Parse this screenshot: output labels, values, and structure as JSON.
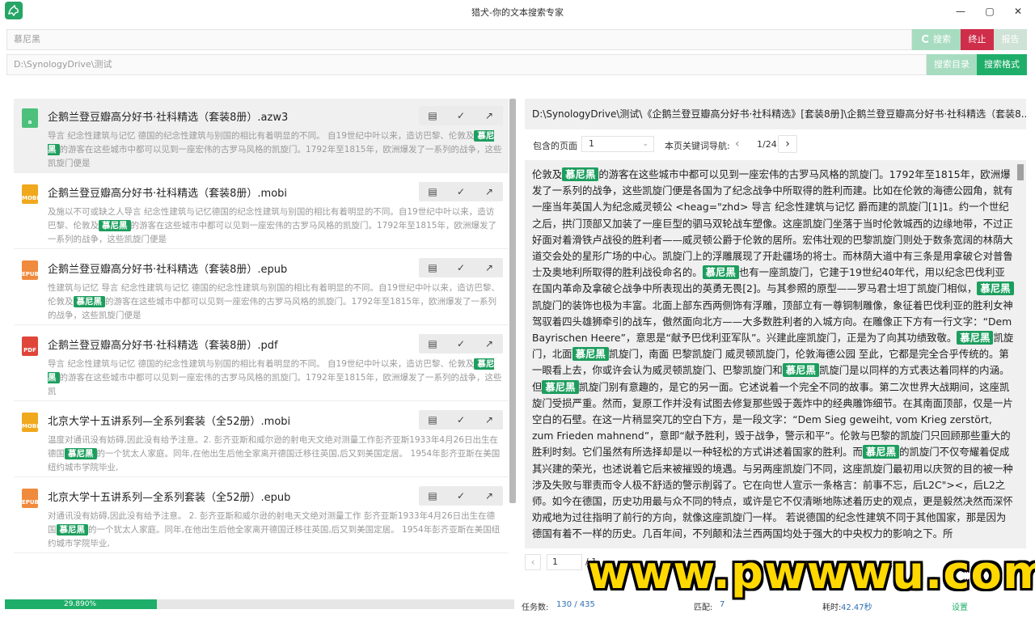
{
  "window": {
    "title": "猎犬-你的文本搜索专家",
    "controls": {
      "minimize": "—",
      "maximize": "▢",
      "close": "✕"
    }
  },
  "search": {
    "keyword": "慕尼黑",
    "search_button": "搜索",
    "stop_button": "终止",
    "report_button": "报告",
    "directory": "D:\\SynologyDrive\\测试",
    "search_dir_button": "搜索目录",
    "search_format_button": "搜索格式"
  },
  "colors": {
    "accent": "#1fae6a",
    "accent_light": "#a7dcc0",
    "stop": "#cf2e4a",
    "report": "#cfe2d6",
    "highlight": "#1c9e5e"
  },
  "results": [
    {
      "icon": "azw3-file-icon",
      "icon_text": "a",
      "icon_color": "#4cc07c",
      "title": "企鹅兰登豆瓣高分好书·社科精选（套装8册）.azw3",
      "snippet_pre": "导言 纪念性建筑与记忆 德国的纪念性建筑与别国的相比有着明显的不同。 自19世纪中叶以来，造访巴黎、伦敦及",
      "keyword": "慕尼黑",
      "snippet_post": "的游客在这些城市中都可以见到一座宏伟的古罗马风格的凯旋门。1792年至1815年，欧洲爆发了一系列的战争，这些凯旋门便是"
    },
    {
      "icon": "mobi-file-icon",
      "icon_text": "MOBI",
      "icon_color": "#f0a81c",
      "title": "企鹅兰登豆瓣高分好书·社科精选（套装8册）.mobi",
      "snippet_pre": "及施以不可或缺之人导言 纪念性建筑与记忆德国的纪念性建筑与别国的相比有着明显的不同。自19世纪中叶以来，造访巴黎、伦敦及",
      "keyword": "慕尼黑",
      "snippet_post": "的游客在这些城市中都可以见到一座宏伟的古罗马风格的凯旋门。1792年至1815年，欧洲爆发了一系列的战争，这些凯旋门便是"
    },
    {
      "icon": "epub-file-icon",
      "icon_text": "EPUB",
      "icon_color": "#f08a3c",
      "title": "企鹅兰登豆瓣高分好书·社科精选（套装8册）.epub",
      "snippet_pre": "性建筑与记忆 导言 纪念性建筑与记忆 德国的纪念性建筑与别国的相比有着明显的不同。自19世纪中叶以来，造访巴黎、伦敦及",
      "keyword": "慕尼黑",
      "snippet_post": "的游客在这些城市中都可以见到一座宏伟的古罗马风格的凯旋门。1792年至1815年，欧洲爆发了一系列的战争，这些凯旋门便是"
    },
    {
      "icon": "pdf-file-icon",
      "icon_text": "PDF",
      "icon_color": "#e0453a",
      "title": "企鹅兰登豆瓣高分好书·社科精选（套装8册）.pdf",
      "snippet_pre": "导言 纪念性建筑与记忆 德国的纪念性建筑与别国的相比有着明显的不同。 自19世纪中叶以来，造访巴黎、伦敦及",
      "keyword": "慕尼黑",
      "snippet_post": "的游客在这些城市中都可以见到一座宏伟的古罗马风格的凯旋门。1792年至1815年，欧洲爆发了一系列的战争，这些凯"
    },
    {
      "icon": "mobi-file-icon",
      "icon_text": "MOBI",
      "icon_color": "#f0a81c",
      "title": "北京大学十五讲系列—全系列套装（全52册）.mobi",
      "snippet_pre": "温度对通讯没有妨碍,因此没有给予注意。2. 彭齐亚斯和威尔逊的射电天文绝对测量工作彭齐亚斯1933年4月26日出生在德国",
      "keyword": "慕尼黑",
      "snippet_post": "的一个犹太人家庭。同年,在他出生后他全家离开德国迁移往英国,后又到美国定居。 1954年彭齐亚斯在美国纽约城市学院毕业,"
    },
    {
      "icon": "epub-file-icon",
      "icon_text": "EPUB",
      "icon_color": "#f08a3c",
      "title": "北京大学十五讲系列—全系列套装（全52册）.epub",
      "snippet_pre": "对通讯没有妨碍,因此没有给予注意。 2. 彭齐亚斯和威尔逊的射电天文绝对测量工作 彭齐亚斯1933年4月26日出生在德国",
      "keyword": "慕尼黑",
      "snippet_post": "的一个犹太人家庭。同年,在他出生后他全家离开德国迁移往英国,后又到美国定居。 1954年彭齐亚斯在美国纽约城市学院毕业,"
    }
  ],
  "detail": {
    "path": "D:\\SynologyDrive\\测试\\《企鹅兰登豆瓣高分好书·社科精选》[套装8册]\\企鹅兰登豆瓣高分好书·社科精选（套装8...",
    "pages_label": "包含的页面",
    "page_select": "1",
    "keyword_nav_label": "本页关键词导航:",
    "keyword_index": "1/24",
    "page_input": "1",
    "page_total": "/ 1",
    "preview": [
      {
        "t": "伦敦及"
      },
      {
        "k": "慕尼黑"
      },
      {
        "t": "的游客在这些城市中都可以见到一座宏伟的古罗马风格的凯旋门。1792年至1815年，欧洲爆发了一系列的战争，这些凯旋门便是各国为了纪念战争中所取得的胜利而建。比如在伦敦的海德公园角，就有一座当年英国人为纪念威灵顿公 <heag=\"zhd> 导言 纪念性建筑与记忆 爵而建的凯旋门[1]1。约一个世纪之后，拱门顶部又加装了一座巨型的驷马双轮战车塑像。这座凯旋门坐落于当时伦敦城西的边缘地带，不过正好面对着滑铁卢战役的胜利者——威灵顿公爵于伦敦的居所。宏伟壮观的巴黎凯旋门则处于数条宽阔的林荫大道交会处的星形广场的中心。凯旋门上的浮雕展现了开赴疆场的将士。而林荫大道中有三条是用拿破仑对普鲁士及奥地利所取得的胜利战役命名的。"
      },
      {
        "k": "慕尼黑"
      },
      {
        "t": "也有一座凯旋门，它建于19世纪40年代，用以纪念巴伐利亚在国内革命及拿破仑战争中所表现出的英勇无畏[2]。与其参照的原型——罗马君士坦丁凯旋门相似，"
      },
      {
        "k": "慕尼黑"
      },
      {
        "t": "凯旋门的装饰也极为丰富。北面上部东西两侧饰有浮雕，顶部立有一尊铜制雕像，象征着巴伐利亚的胜利女神驾驭着四头雄狮牵引的战车，傲然面向北方——大多数胜利者的入城方向。在雕像正下方有一行文字：“Dem Bayrischen Heere”，意思是“献予巴伐利亚军队”。兴建此座凯旋门，正是为了向其功绩致敬。"
      },
      {
        "k": "慕尼黑"
      },
      {
        "t": "凯旋门，北面"
      },
      {
        "k": "慕尼黑"
      },
      {
        "t": "凯旋门，南面 巴黎凯旋门 威灵顿凯旋门，伦敦海德公园 至此，它都是完全合乎传统的。第一眼看上去，你或许会认为威灵顿凯旋门、巴黎凯旋门和"
      },
      {
        "k": "慕尼黑"
      },
      {
        "t": "凯旋门是以同样的方式表达着同样的内涵。但"
      },
      {
        "k": "慕尼黑"
      },
      {
        "t": "凯旋门别有意趣的，是它的另一面。它述说着一个完全不同的故事。第二次世界大战期间，这座凯旋门受损严重。然而，复原工作并没有试图去修复那些毁于轰炸中的经典雕饰细节。在其南面顶部，仅是一片空白的石壁。在这一片稍显突兀的空白下方，是一段文字：“Dem Sieg geweiht, vom Krieg zerstört, zum Frieden mahnend”，意即“献予胜利，毁于战争，警示和平”。伦敦与巴黎的凯旋门只回顾那些重大的胜利时刻。它们虽然有所选择却是以一种轻松的方式讲述着国家的胜利。而"
      },
      {
        "k": "慕尼黑"
      },
      {
        "t": "的凯旋门不仅夸耀着促成其兴建的荣光，也述说着它后来被摧毁的境遇。与另两座凯旋门不同，这座凯旋门最初用以庆贺的目的被一种涉及失败与罪责而令人极不舒适的警示削弱了。它在向世人宣示一条格言：前事不忘，后L2C\"><，后L2之师。如今在德国，历史功用最与众不同的特点，或许是它不仅清晰地陈述着历史的观点，更是毅然决然而深怀劝戒地为过往指明了前行的方向，就像这座凯旋门一样。 若说德国的纪念性建筑不同于其他国家，那是因为德国有着不一样的历史。几百年间，不列颠和法兰西两国均处于强大的中央权力的影响之下。所"
      }
    ]
  },
  "status": {
    "progress_percent": 29.89,
    "progress_text": "29.890%",
    "tasks_label": "任务数:",
    "tasks_value": "130 / 435",
    "matches_label": "匹配:",
    "matches_value": "7",
    "elapsed_label": "耗时:",
    "elapsed_value": "42.47秒",
    "settings_link": "设置"
  },
  "watermark": "www.pwwwu.com"
}
